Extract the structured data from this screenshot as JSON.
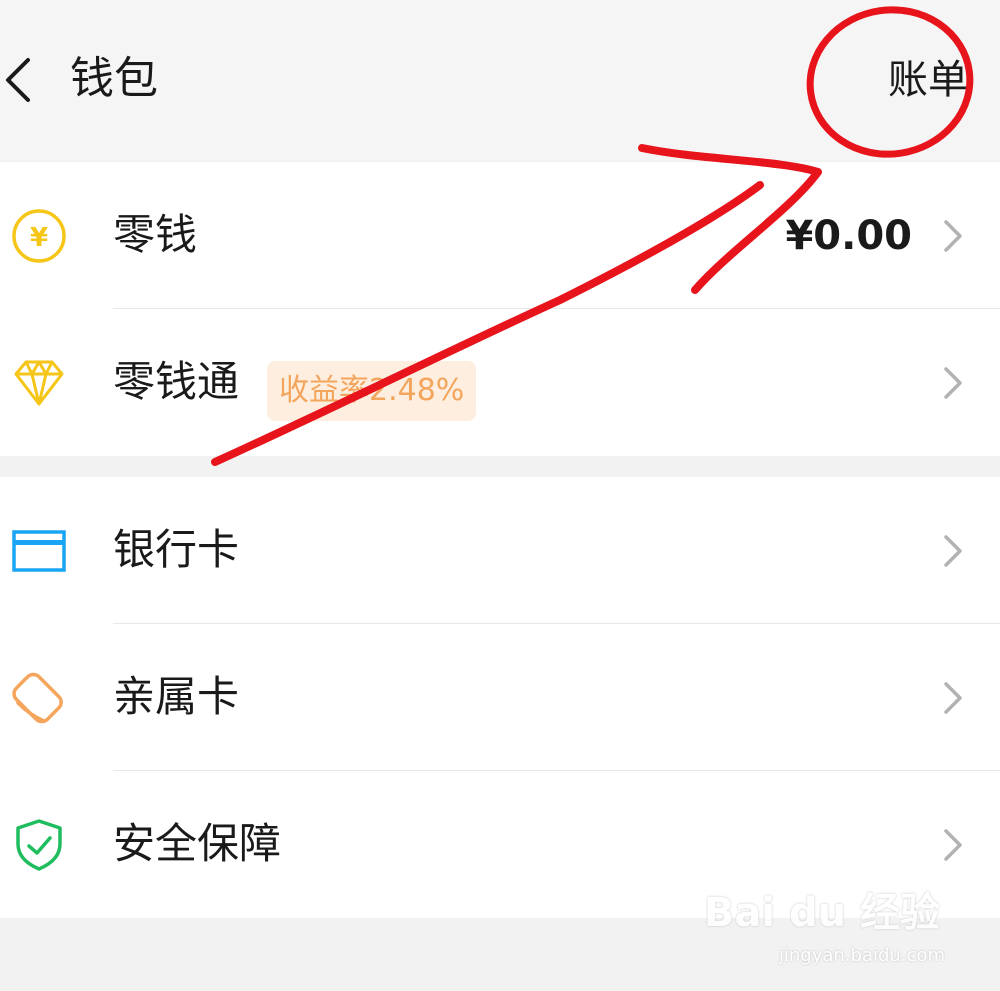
{
  "header": {
    "back_icon": "chevron-left-icon",
    "title": "钱包",
    "bill_label": "账单"
  },
  "group1": {
    "items": [
      {
        "label": "零钱",
        "icon": "yuan-coin-icon",
        "value": "¥0.00"
      },
      {
        "label": "零钱通",
        "icon": "diamond-icon",
        "badge": "收益率2.48%"
      }
    ]
  },
  "group2": {
    "items": [
      {
        "label": "银行卡",
        "icon": "bank-card-icon"
      },
      {
        "label": "亲属卡",
        "icon": "family-card-icon"
      },
      {
        "label": "安全保障",
        "icon": "shield-check-icon"
      }
    ]
  },
  "watermark": {
    "brand": "Bai du 经验",
    "url": "jingyan.baidu.com"
  },
  "colors": {
    "coin": "#f5c518",
    "diamond": "#f5c518",
    "bank_card": "#1aa5f4",
    "family_card": "#f5a55c",
    "shield": "#1fbd5e",
    "badge_bg": "#fdeee0",
    "badge_text": "#f3a55c",
    "annotation": "#e8141c"
  }
}
